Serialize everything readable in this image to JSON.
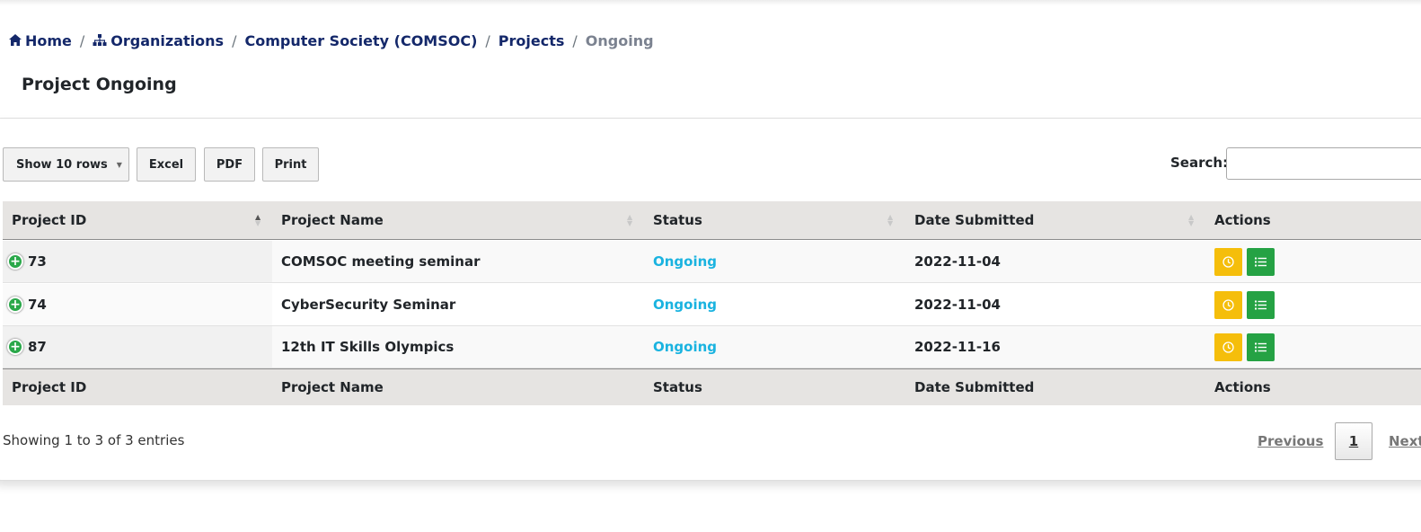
{
  "breadcrumb": {
    "home": "Home",
    "organizations": "Organizations",
    "organization": "Computer Society (COMSOC)",
    "projects": "Projects",
    "current": "Ongoing",
    "separator": "/"
  },
  "page_title": "Project Ongoing",
  "toolbar": {
    "rows_label": "Show 10 rows",
    "excel_label": "Excel",
    "pdf_label": "PDF",
    "print_label": "Print",
    "search_label": "Search:",
    "search_value": ""
  },
  "table": {
    "headers": [
      "Project ID",
      "Project Name",
      "Status",
      "Date Submitted",
      "Actions"
    ],
    "rows": [
      {
        "id": "73",
        "name": "COMSOC meeting seminar",
        "status": "Ongoing",
        "date": "2022-11-04"
      },
      {
        "id": "74",
        "name": "CyberSecurity Seminar",
        "status": "Ongoing",
        "date": "2022-11-04"
      },
      {
        "id": "87",
        "name": "12th IT Skills Olympics",
        "status": "Ongoing",
        "date": "2022-11-16"
      }
    ]
  },
  "footer": {
    "info": "Showing 1 to 3 of 3 entries",
    "previous": "Previous",
    "page": "1",
    "next": "Next"
  },
  "icons": {
    "expand": "plus-circle-icon",
    "clock": "clock-icon",
    "list": "list-icon"
  },
  "colors": {
    "link": "#14286a",
    "status": "#1ab3e0",
    "clock_button": "#f5be0b",
    "list_button": "#25a244"
  }
}
